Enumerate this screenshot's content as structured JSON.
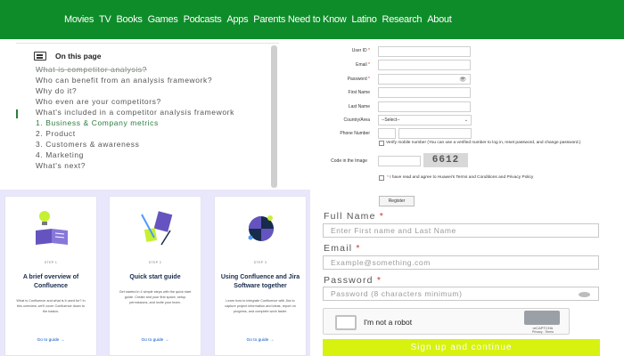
{
  "nav": {
    "items": [
      "Movies",
      "TV",
      "Books",
      "Games",
      "Podcasts",
      "Apps",
      "Parents Need to Know",
      "Latino",
      "Research",
      "About"
    ]
  },
  "on_this_page": {
    "title": "On this page",
    "items": [
      "What is competitor analysis?",
      "Who can benefit from an analysis framework?",
      "Why do it?",
      "Who even are your competitors?",
      "What's included in a competitor analysis framework",
      "1. Business & Company metrics",
      "2. Product",
      "3. Customers & awareness",
      "4. Marketing",
      "What's next?"
    ]
  },
  "guides": [
    {
      "step": "STEP 1",
      "title": "A brief overview of Confluence",
      "desc": "What is Confluence and what is it used for? In this overview, we'll cover Confluence down to the basics.",
      "link": "Go to guide →"
    },
    {
      "step": "STEP 2",
      "title": "Quick start guide",
      "desc": "Get started in 4 simple steps with the quick start guide. Create and your first space, setup permissions, and invite your team.",
      "link": "Go to guide →"
    },
    {
      "step": "STEP 3",
      "title": "Using Confluence and Jira Software together",
      "desc": "Learn how to integrate Confluence with Jira to capture project information and ideas, report on progress, and complete work faster.",
      "link": "Go to guide →"
    }
  ],
  "registration": {
    "user_id": "User ID",
    "email": "Email",
    "password": "Password",
    "first_name": "First Name",
    "last_name": "Last Name",
    "country": "Country/Area",
    "country_value": "--Select--",
    "phone": "Phone Number",
    "verify_text": "Verify mobile number (You can use a verified number to log in, reset password, and change password.)",
    "captcha_label": "Code in the Image",
    "captcha_code": "6612",
    "agree_text": "I have read and agree to Huawei's Terms and Conditions and Privacy Policy",
    "register_button": "Register",
    "required_mark": "*"
  },
  "signup": {
    "full_name_label": "Full Name",
    "full_name_placeholder": "Enter First name and Last Name",
    "email_label": "Email",
    "email_placeholder": "Example@something.com",
    "password_label": "Password",
    "password_placeholder": "Password (8 characters minimum)",
    "required_mark": "*",
    "recaptcha_text": "I'm not a robot",
    "recaptcha_brand": "reCAPTCHA",
    "recaptcha_terms": "Privacy - Terms",
    "submit_label": "Sign up and continue"
  },
  "colors": {
    "nav_bg": "#0f8c2a",
    "guides_bg": "#e9e7fb",
    "submit_bg": "#d7f20f",
    "active_item": "#2b7d3e"
  }
}
